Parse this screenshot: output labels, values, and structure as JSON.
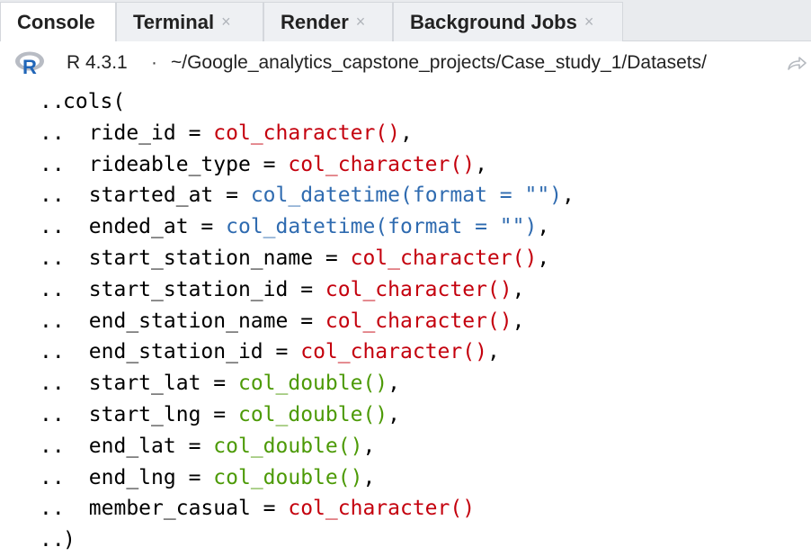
{
  "tabs": [
    {
      "label": "Console",
      "active": true,
      "closable": false
    },
    {
      "label": "Terminal",
      "active": false,
      "closable": true
    },
    {
      "label": "Render",
      "active": false,
      "closable": true
    },
    {
      "label": "Background Jobs",
      "active": false,
      "closable": true
    }
  ],
  "close_glyph": "×",
  "pathbar": {
    "r_version": "R 4.3.1",
    "separator": "·",
    "path": "~/Google_analytics_capstone_projects/Case_study_1/Datasets/"
  },
  "colors": {
    "character": "#c4000d",
    "datetime": "#2f6bb0",
    "double": "#4c9a06"
  },
  "console": {
    "lines": [
      {
        "prompt": "..",
        "indent": 1,
        "name": "cols(",
        "eq": "",
        "call": "",
        "cls": "",
        "tail": ""
      },
      {
        "prompt": "..",
        "indent": 3,
        "name": "ride_id",
        "eq": " = ",
        "call": "col_character()",
        "cls": "red",
        "tail": ","
      },
      {
        "prompt": "..",
        "indent": 3,
        "name": "rideable_type",
        "eq": " = ",
        "call": "col_character()",
        "cls": "red",
        "tail": ","
      },
      {
        "prompt": "..",
        "indent": 3,
        "name": "started_at",
        "eq": " = ",
        "call": "col_datetime(format = \"\")",
        "cls": "blue",
        "tail": ","
      },
      {
        "prompt": "..",
        "indent": 3,
        "name": "ended_at",
        "eq": " = ",
        "call": "col_datetime(format = \"\")",
        "cls": "blue",
        "tail": ","
      },
      {
        "prompt": "..",
        "indent": 3,
        "name": "start_station_name",
        "eq": " = ",
        "call": "col_character()",
        "cls": "red",
        "tail": ","
      },
      {
        "prompt": "..",
        "indent": 3,
        "name": "start_station_id",
        "eq": " = ",
        "call": "col_character()",
        "cls": "red",
        "tail": ","
      },
      {
        "prompt": "..",
        "indent": 3,
        "name": "end_station_name",
        "eq": " = ",
        "call": "col_character()",
        "cls": "red",
        "tail": ","
      },
      {
        "prompt": "..",
        "indent": 3,
        "name": "end_station_id",
        "eq": " = ",
        "call": "col_character()",
        "cls": "red",
        "tail": ","
      },
      {
        "prompt": "..",
        "indent": 3,
        "name": "start_lat",
        "eq": " = ",
        "call": "col_double()",
        "cls": "green",
        "tail": ","
      },
      {
        "prompt": "..",
        "indent": 3,
        "name": "start_lng",
        "eq": " = ",
        "call": "col_double()",
        "cls": "green",
        "tail": ","
      },
      {
        "prompt": "..",
        "indent": 3,
        "name": "end_lat",
        "eq": " = ",
        "call": "col_double()",
        "cls": "green",
        "tail": ","
      },
      {
        "prompt": "..",
        "indent": 3,
        "name": "end_lng",
        "eq": " = ",
        "call": "col_double()",
        "cls": "green",
        "tail": ","
      },
      {
        "prompt": "..",
        "indent": 3,
        "name": "member_casual",
        "eq": " = ",
        "call": "col_character()",
        "cls": "red",
        "tail": ""
      },
      {
        "prompt": "..",
        "indent": 1,
        "name": ")",
        "eq": "",
        "call": "",
        "cls": "",
        "tail": ""
      }
    ]
  }
}
